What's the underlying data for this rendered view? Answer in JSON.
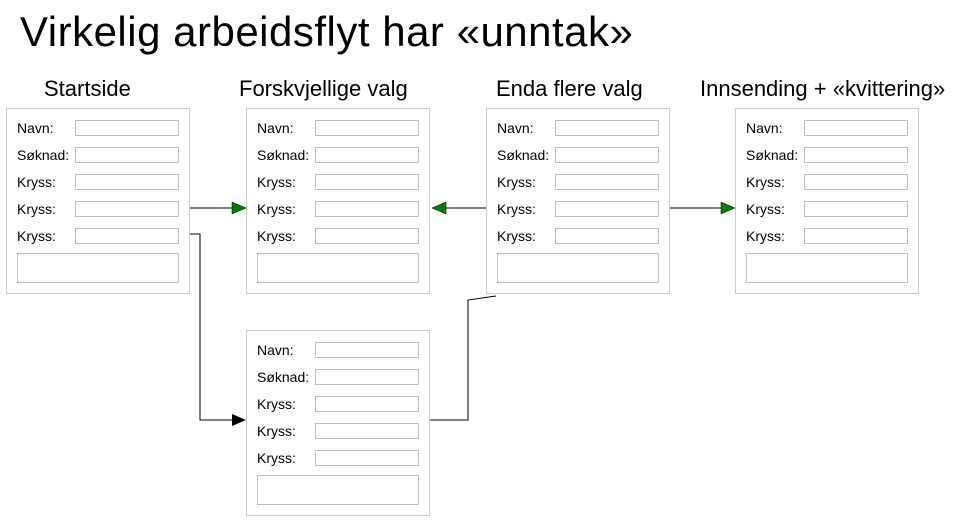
{
  "title": "Virkelig arbeidsflyt har «unntak»",
  "columns": {
    "c1": "Startside",
    "c2": "Forskvjellige valg",
    "c3": "Enda flere valg",
    "c4": "Innsending + «kvittering»"
  },
  "labels": {
    "navn": "Navn:",
    "soknad": "Søknad:",
    "kryss": "Kryss:"
  }
}
